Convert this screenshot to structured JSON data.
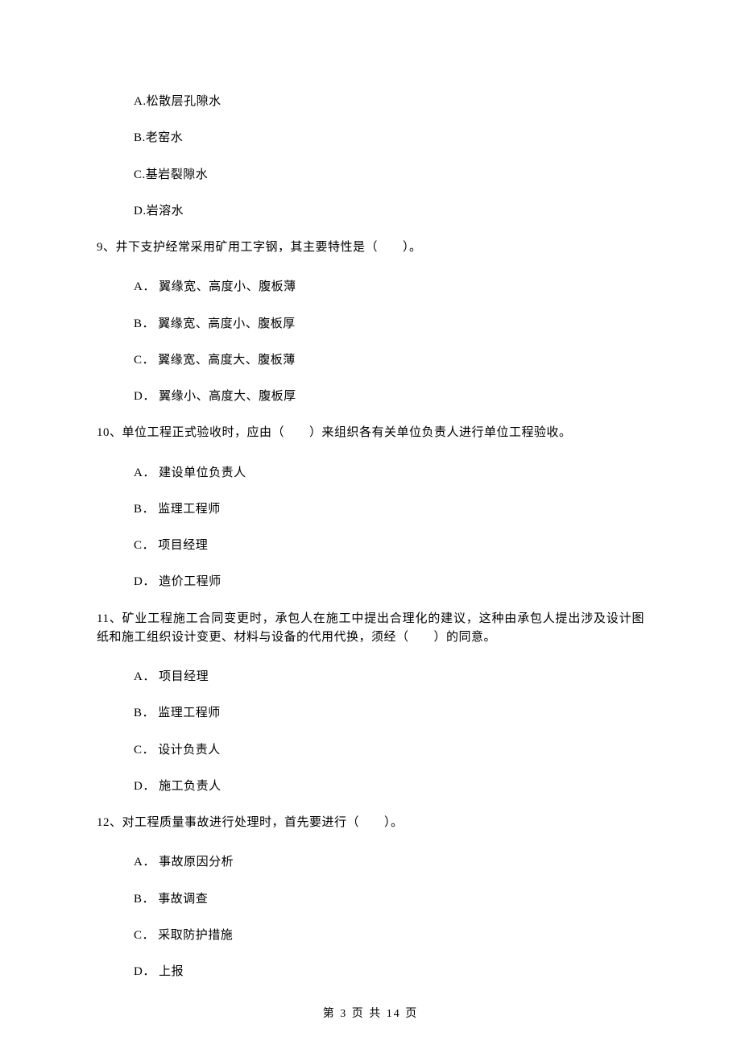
{
  "q8": {
    "options": {
      "A": "A.松散层孔隙水",
      "B": "B.老窑水",
      "C": "C.基岩裂隙水",
      "D": "D.岩溶水"
    }
  },
  "q9": {
    "stem": "9、井下支护经常采用矿用工字钢，其主要特性是（　　）。",
    "options": {
      "A": "A． 翼缘宽、高度小、腹板薄",
      "B": "B． 翼缘宽、高度小、腹板厚",
      "C": "C． 翼缘宽、高度大、腹板薄",
      "D": "D． 翼缘小、高度大、腹板厚"
    }
  },
  "q10": {
    "stem": "10、单位工程正式验收时，应由（　　）来组织各有关单位负责人进行单位工程验收。",
    "options": {
      "A": "A． 建设单位负责人",
      "B": "B． 监理工程师",
      "C": "C． 项目经理",
      "D": "D． 造价工程师"
    }
  },
  "q11": {
    "stem": "11、矿业工程施工合同变更时，承包人在施工中提出合理化的建议，这种由承包人提出涉及设计图纸和施工组织设计变更、材料与设备的代用代换，须经（　　）的同意。",
    "options": {
      "A": "A． 项目经理",
      "B": "B． 监理工程师",
      "C": "C． 设计负责人",
      "D": "D． 施工负责人"
    }
  },
  "q12": {
    "stem": "12、对工程质量事故进行处理时，首先要进行（　　）。",
    "options": {
      "A": "A． 事故原因分析",
      "B": "B． 事故调查",
      "C": "C． 采取防护措施",
      "D": "D． 上报"
    }
  },
  "footer": "第 3 页 共 14 页"
}
